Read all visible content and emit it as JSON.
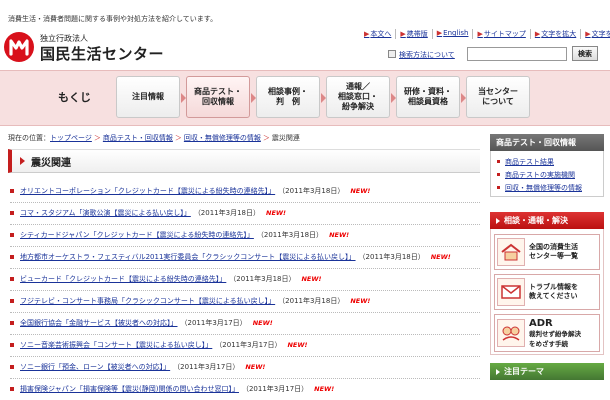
{
  "header": {
    "tagline": "消費生活・消費者問題に関する事例や対処方法を紹介しています。",
    "logo_sub": "独立行政法人",
    "logo_main": "国民生活センター",
    "util_links": [
      {
        "label": "本文へ"
      },
      {
        "label": "携帯版"
      },
      {
        "label": "English"
      },
      {
        "label": "サイトマップ"
      },
      {
        "label": "文字を拡大"
      },
      {
        "label": "文字を縮小"
      }
    ],
    "search_method": "検索方法について",
    "search_button": "検索",
    "search_value": ""
  },
  "nav": {
    "title": "もくじ",
    "items": [
      {
        "label": "注目情報"
      },
      {
        "label": "商品テスト・\n回収情報"
      },
      {
        "label": "相談事例・\n判　例"
      },
      {
        "label": "通報／\n相談窓口・\n紛争解決"
      },
      {
        "label": "研修・資料・\n相談員資格"
      },
      {
        "label": "当センター\nについて"
      }
    ]
  },
  "breadcrumb": {
    "prefix": "現在の位置：",
    "items": [
      "トップページ",
      "商品テスト・回収情報",
      "回収・無償修理等の情報",
      "震災関連"
    ]
  },
  "section": {
    "title": "震災関連"
  },
  "news": [
    {
      "link": "オリエントコーポレーション「クレジットカード【震災による紛失時の連絡先】」",
      "date": "（2011年3月18日）",
      "new": "NEW!"
    },
    {
      "link": "コマ・スタジアム「演歌公演【震災による払い戻し】」",
      "date": "（2011年3月18日）",
      "new": "NEW!"
    },
    {
      "link": "シティカードジャパン「クレジットカード【震災による紛失時の連絡先】」",
      "date": "（2011年3月18日）",
      "new": "NEW!"
    },
    {
      "link": "地方都市オーケストラ・フェスティバル2011実行委員会「クラシックコンサート【震災による払い戻し】」",
      "date": "（2011年3月18日）",
      "new": "NEW!"
    },
    {
      "link": "ビューカード「クレジットカード【震災による紛失時の連絡先】」",
      "date": "（2011年3月18日）",
      "new": "NEW!"
    },
    {
      "link": "フジテレビ・コンサート事務局「クラシックコンサート【震災による払い戻し】」",
      "date": "（2011年3月18日）",
      "new": "NEW!"
    },
    {
      "link": "全国銀行協会「金融サービス【被災者への対応】」",
      "date": "（2011年3月17日）",
      "new": "NEW!"
    },
    {
      "link": "ソニー音楽芸術振興会「コンサート【震災による払い戻し】」",
      "date": "（2011年3月17日）",
      "new": "NEW!"
    },
    {
      "link": "ソニー銀行「預金、ローン【被災者への対応】」",
      "date": "（2011年3月17日）",
      "new": "NEW!"
    },
    {
      "link": "損害保険ジャパン「損害保険等【震災(静岡)関係の問い合わせ窓口】」",
      "date": "（2011年3月17日）",
      "new": "NEW!"
    }
  ],
  "sidebar": {
    "test_head": "商品テスト・回収情報",
    "test_links": [
      "商品テスト結果",
      "商品テストの実施機関",
      "回収・無償修理等の情報"
    ],
    "consult_head": "相談・通報・解決",
    "promos": [
      {
        "line1": "全国の消費生活",
        "line2": "センター等一覧"
      },
      {
        "line1": "トラブル情報を",
        "line2": "教えてください"
      },
      {
        "big": "ADR",
        "line1": "裁判せず紛争解決",
        "line2": "をめざす手続"
      }
    ],
    "theme_head": "注目テーマ"
  },
  "colors": {
    "brand_red": "#d8101b",
    "nav_band": "#f7e0e0",
    "link_blue": "#1a3399",
    "new_red": "#ee0000"
  }
}
